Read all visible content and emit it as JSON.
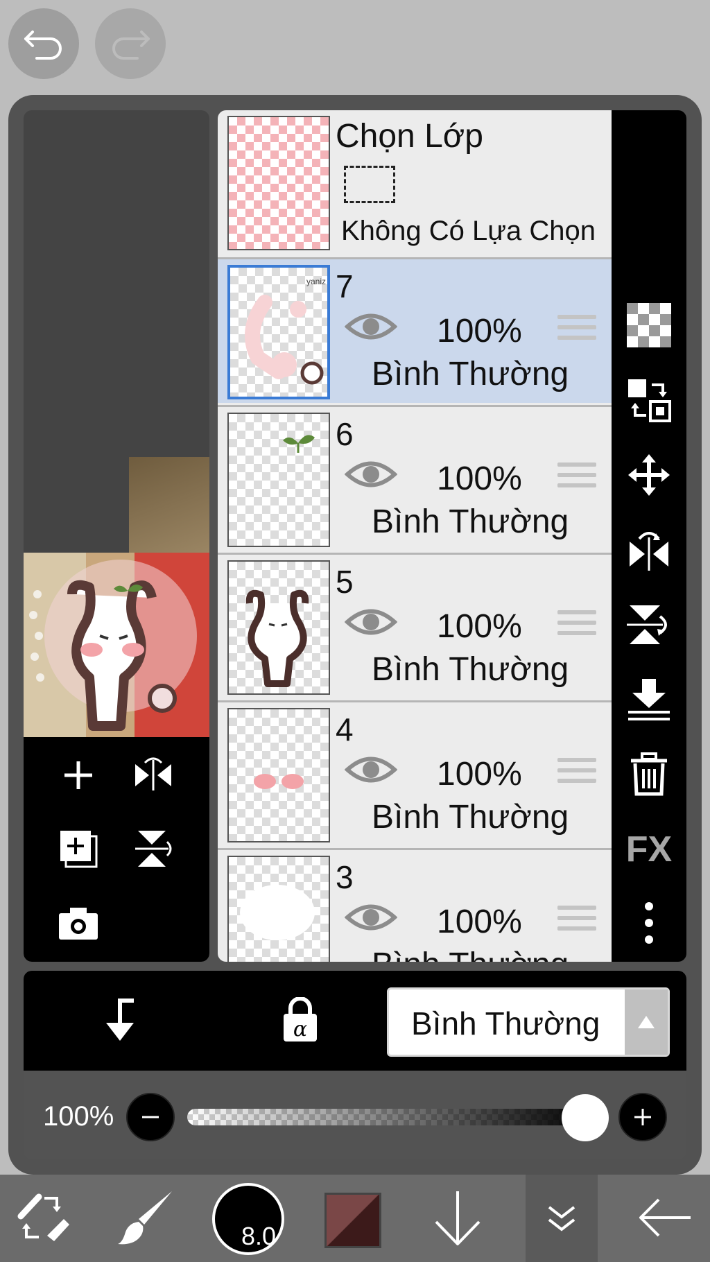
{
  "selection": {
    "title": "Chọn Lớp",
    "subtitle": "Không Có Lựa Chọn"
  },
  "layers": [
    {
      "number": "7",
      "opacity": "100%",
      "blend": "Bình Thường",
      "selected": true
    },
    {
      "number": "6",
      "opacity": "100%",
      "blend": "Bình Thường",
      "selected": false
    },
    {
      "number": "5",
      "opacity": "100%",
      "blend": "Bình Thường",
      "selected": false
    },
    {
      "number": "4",
      "opacity": "100%",
      "blend": "Bình Thường",
      "selected": false
    },
    {
      "number": "3",
      "opacity": "100%",
      "blend": "Bình Thường",
      "selected": false
    }
  ],
  "sidebar": {
    "fx_label": "FX"
  },
  "blend_mode": {
    "value": "Bình Thường"
  },
  "opacity_control": {
    "label": "100%",
    "value_percent": 100
  },
  "toolbar": {
    "brush_size": "8.0",
    "primary_color": "#7a4747",
    "secondary_color": "#3c1a1a"
  },
  "colors": {
    "selected_row": "#cbd8ec",
    "selected_border": "#3a7bd5",
    "panel": "#525252"
  }
}
